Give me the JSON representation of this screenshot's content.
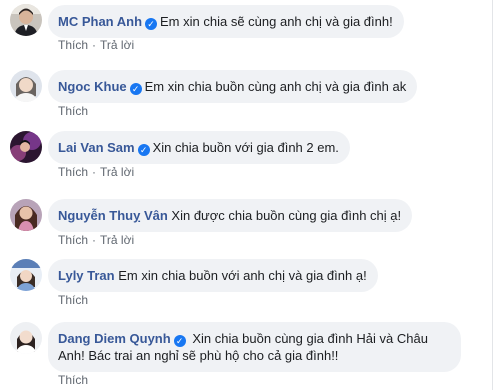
{
  "comments": [
    {
      "name": "MC Phan Anh",
      "verified": true,
      "text": "Em xin chia sẽ cùng anh chị và gia đình!",
      "like": "Thích",
      "reply": "Trả lời"
    },
    {
      "name": "Ngoc Khue",
      "verified": true,
      "text": "Em xin chia buồn cùng anh chị và gia đình ak",
      "like": "Thích",
      "reply": ""
    },
    {
      "name": "Lai Van Sam",
      "verified": true,
      "text": "Xin chia buồn với gia đình 2 em.",
      "like": "Thích",
      "reply": "Trả lời"
    },
    {
      "name": "Nguyễn Thuỵ Vân",
      "verified": false,
      "text": "Xin được chia buồn cùng gia đình chị ạ!",
      "like": "Thích",
      "reply": "Trả lời"
    },
    {
      "name": "Lyly Tran",
      "verified": false,
      "text": "Em xin chia buồn với anh chị và gia đình ạ!",
      "like": "Thích",
      "reply": ""
    },
    {
      "name": "Dang Diem Quynh",
      "verified": true,
      "text": "Xin chia buồn cùng gia đình Hải và Châu Anh! Bác trai an nghỉ sẽ phù hộ cho cả gia đình!!",
      "like": "Thích",
      "reply": ""
    }
  ],
  "colors": {
    "name": "#385898",
    "bubble": "#f0f2f5",
    "verified": "#1877f2",
    "action": "#606770"
  },
  "icons": {
    "verified": "verified-check-icon"
  }
}
